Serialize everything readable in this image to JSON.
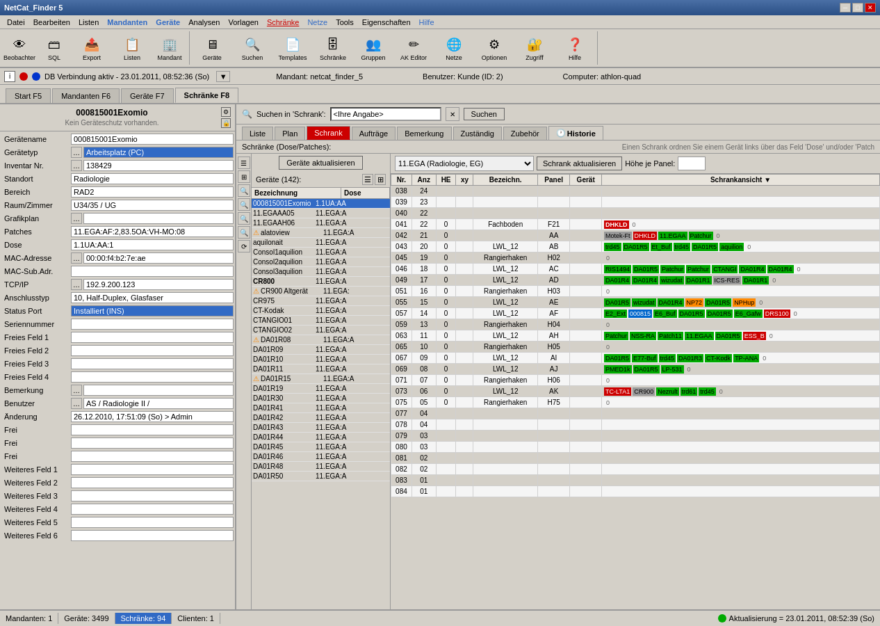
{
  "app": {
    "title": "NetCat_Finder 5",
    "controls": {
      "min": "─",
      "max": "□",
      "close": "✕"
    }
  },
  "menu": {
    "items": [
      "Datei",
      "Bearbeiten",
      "Listen",
      "Mandanten",
      "Geräte",
      "Analysen",
      "Vorlagen",
      "Schränke",
      "Netze",
      "Tools",
      "Eigenschaften",
      "Hilfe"
    ]
  },
  "toolbar": {
    "buttons": [
      {
        "label": "Beobachter",
        "icon": "👁"
      },
      {
        "label": "SQL",
        "icon": "🗃"
      },
      {
        "label": "Export",
        "icon": "📤"
      },
      {
        "label": "Listen",
        "icon": "📋"
      },
      {
        "label": "Mandant",
        "icon": "🏢"
      },
      {
        "label": "Geräte",
        "icon": "🖥"
      },
      {
        "label": "Suchen",
        "icon": "🔍"
      },
      {
        "label": "Templates",
        "icon": "📄"
      },
      {
        "label": "Schränke",
        "icon": "🗄"
      },
      {
        "label": "Gruppen",
        "icon": "👥"
      },
      {
        "label": "AK Editor",
        "icon": "✏"
      },
      {
        "label": "Netze",
        "icon": "🌐"
      },
      {
        "label": "Optionen",
        "icon": "⚙"
      },
      {
        "label": "Zugriff",
        "icon": "🔐"
      },
      {
        "label": "Hilfe",
        "icon": "❓"
      }
    ]
  },
  "status_top": {
    "info": "DB Verbindung aktiv - 23.01.2011, 08:52:36 (So)",
    "mandant": "Mandant: netcat_finder_5",
    "benutzer": "Benutzer: Kunde (ID: 2)",
    "computer": "Computer: athlon-quad"
  },
  "tabs": [
    {
      "label": "Start  F5"
    },
    {
      "label": "Mandanten  F6"
    },
    {
      "label": "Geräte  F7"
    },
    {
      "label": "Schränke  F8",
      "active": true
    }
  ],
  "device_header": {
    "title": "000815001Exomio",
    "subtitle": "Kein Geräteschutz vorhanden."
  },
  "device_fields": [
    {
      "label": "Gerätename",
      "value": "000815001Exomio",
      "icon": false
    },
    {
      "label": "Gerätetyp",
      "value": "Arbeitsplatz (PC)",
      "blue": true,
      "icon": true
    },
    {
      "label": "Inventar Nr.",
      "value": "138429",
      "icon": true
    },
    {
      "label": "Standort",
      "value": "Radiologie"
    },
    {
      "label": "Bereich",
      "value": "RAD2"
    },
    {
      "label": "Raum/Zimmer",
      "value": "U34/35 / UG"
    },
    {
      "label": "Grafikplan",
      "value": "",
      "icon": true
    },
    {
      "label": "Patches",
      "value": "11.EGA:AF:2,83.5OA:VH-MO:08"
    },
    {
      "label": "Dose",
      "value": "1.1UA:AA:1"
    },
    {
      "label": "MAC-Adresse",
      "value": "00:00:f4:b2:7e:ae",
      "icon": true
    },
    {
      "label": "MAC-Sub.Adr.",
      "value": ""
    },
    {
      "label": "TCP/IP",
      "value": "192.9.200.123",
      "icon": true
    },
    {
      "label": "Anschlusstyp",
      "value": "10, Half-Duplex, Glasfaser"
    },
    {
      "label": "Status Port",
      "value": "Installiert (INS)",
      "blue": true
    },
    {
      "label": "Seriennummer",
      "value": ""
    },
    {
      "label": "Freies Feld 1",
      "value": ""
    },
    {
      "label": "Freies Feld 2",
      "value": ""
    },
    {
      "label": "Freies Feld 3",
      "value": ""
    },
    {
      "label": "Freies Feld 4",
      "value": ""
    },
    {
      "label": "Bemerkung",
      "value": "",
      "icon": true
    },
    {
      "label": "Benutzer",
      "value": "AS / Radiologie II /",
      "icon": true
    },
    {
      "label": "Änderung",
      "value": "26.12.2010, 17:51:09 (So) > Admin"
    },
    {
      "label": "Frei",
      "value": ""
    },
    {
      "label": "Frei",
      "value": ""
    },
    {
      "label": "Frei",
      "value": ""
    },
    {
      "label": "Weiteres Feld 1",
      "value": ""
    },
    {
      "label": "Weiteres Feld 2",
      "value": ""
    },
    {
      "label": "Weiteres Feld 3",
      "value": ""
    },
    {
      "label": "Weiteres Feld 4",
      "value": ""
    },
    {
      "label": "Weiteres Feld 5",
      "value": ""
    },
    {
      "label": "Weiteres Feld 6",
      "value": ""
    }
  ],
  "search": {
    "label": "Suchen in 'Schrank':",
    "placeholder": "<Ihre Angabe>",
    "btn": "Suchen"
  },
  "sub_tabs": [
    {
      "label": "Liste"
    },
    {
      "label": "Plan"
    },
    {
      "label": "Schrank",
      "active": true
    },
    {
      "label": "Aufträge"
    },
    {
      "label": "Bemerkung"
    },
    {
      "label": "Zuständig"
    },
    {
      "label": "Zubehör"
    },
    {
      "label": "Historie"
    }
  ],
  "schrank_info": "Schränke (Dose/Patches):",
  "schrank_help": "Einen Schrank ordnen Sie einem Gerät links über das Feld 'Dose' und/oder 'Patch",
  "schrank_select": "11.EGA  (Radiologie, EG)",
  "schrank_update_btn": "Schrank aktualisieren",
  "hoehe_label": "Höhe je Panel:",
  "geraete_aktualisieren": "Geräte aktualisieren",
  "device_list_header": "Geräte (142):",
  "device_list_cols": [
    "Bezeichnung",
    "Dose"
  ],
  "devices": [
    {
      "name": "000815001Exomio",
      "dose": "1.1UA:AA",
      "selected": true,
      "warning": false
    },
    {
      "name": "11.EGAAA05",
      "dose": "11.EGA:A",
      "selected": false,
      "warning": false
    },
    {
      "name": "11.EGAAH06",
      "dose": "11.EGA:A",
      "selected": false,
      "warning": false
    },
    {
      "name": "alatoview",
      "dose": "11.EGA:A",
      "selected": false,
      "warning": false,
      "alert": true
    },
    {
      "name": "aquilonait",
      "dose": "11.EGA:A",
      "selected": false,
      "warning": false
    },
    {
      "name": "Consol1aquilion",
      "dose": "11.EGA:A",
      "selected": false,
      "warning": false
    },
    {
      "name": "Consol2aquilion",
      "dose": "11.EGA:A",
      "selected": false,
      "warning": false
    },
    {
      "name": "Consol3aquilion",
      "dose": "11.EGA:A",
      "selected": false,
      "warning": false
    },
    {
      "name": "CR800",
      "dose": "11.EGA:A",
      "selected": false,
      "warning": false,
      "bold": true
    },
    {
      "name": "CR900 Altgerät",
      "dose": "11.EGA:",
      "selected": false,
      "warning": true
    },
    {
      "name": "CR975",
      "dose": "11.EGA:A",
      "selected": false,
      "warning": false
    },
    {
      "name": "CT-Kodak",
      "dose": "11.EGA:A",
      "selected": false,
      "warning": false
    },
    {
      "name": "CTANGIO01",
      "dose": "11.EGA:A",
      "selected": false,
      "warning": false
    },
    {
      "name": "CTANGIO02",
      "dose": "11.EGA:A",
      "selected": false,
      "warning": false
    },
    {
      "name": "DA01R08",
      "dose": "11.EGA:A",
      "selected": false,
      "warning": true
    },
    {
      "name": "DA01R09",
      "dose": "11.EGA:A",
      "selected": false,
      "warning": false
    },
    {
      "name": "DA01R10",
      "dose": "11.EGA:A",
      "selected": false,
      "warning": false
    },
    {
      "name": "DA01R11",
      "dose": "11.EGA:A",
      "selected": false,
      "warning": false
    },
    {
      "name": "DA01R15",
      "dose": "11.EGA:A",
      "selected": false,
      "warning": true
    },
    {
      "name": "DA01R19",
      "dose": "11.EGA:A",
      "selected": false,
      "warning": false
    },
    {
      "name": "DA01R30",
      "dose": "11.EGA:A",
      "selected": false,
      "warning": false
    },
    {
      "name": "DA01R41",
      "dose": "11.EGA:A",
      "selected": false,
      "warning": false
    },
    {
      "name": "DA01R42",
      "dose": "11.EGA:A",
      "selected": false,
      "warning": false
    },
    {
      "name": "DA01R43",
      "dose": "11.EGA:A",
      "selected": false,
      "warning": false
    },
    {
      "name": "DA01R44",
      "dose": "11.EGA:A",
      "selected": false,
      "warning": false
    },
    {
      "name": "DA01R45",
      "dose": "11.EGA:A",
      "selected": false,
      "warning": false
    },
    {
      "name": "DA01R46",
      "dose": "11.EGA:A",
      "selected": false,
      "warning": false
    },
    {
      "name": "DA01R48",
      "dose": "11.EGA:A",
      "selected": false,
      "warning": false
    },
    {
      "name": "DA01R50",
      "dose": "11.EGA:A",
      "selected": false,
      "warning": false
    }
  ],
  "schrank_rows": [
    {
      "nr": "038",
      "anz": "24",
      "he": "",
      "xy": "",
      "bez": "",
      "panel": "",
      "geraet": "",
      "devices": []
    },
    {
      "nr": "039",
      "anz": "23",
      "he": "",
      "xy": "",
      "bez": "",
      "panel": "",
      "geraet": "",
      "devices": []
    },
    {
      "nr": "040",
      "anz": "22",
      "he": "",
      "xy": "",
      "bez": "",
      "panel": "",
      "geraet": "",
      "devices": []
    },
    {
      "nr": "041",
      "anz": "22",
      "he": "0",
      "xy": "",
      "bez": "Fachboden",
      "panel": "F21",
      "geraet": "",
      "devices": [
        {
          "label": "DHKLD",
          "color": "red",
          "bold": true
        }
      ]
    },
    {
      "nr": "042",
      "anz": "21",
      "he": "0",
      "xy": "",
      "bez": "",
      "panel": "AA",
      "geraet": "",
      "devices": [
        {
          "label": "Motek-Ft",
          "color": "gray"
        },
        {
          "label": "DHKLD",
          "color": "red"
        },
        {
          "label": "11.EGAA",
          "color": "green"
        },
        {
          "label": "Patchur",
          "color": "green"
        }
      ]
    },
    {
      "nr": "043",
      "anz": "20",
      "he": "0",
      "xy": "",
      "bez": "LWL_12",
      "panel": "AB",
      "geraet": "",
      "devices": [
        {
          "label": "trd45",
          "color": "green"
        },
        {
          "label": "DA01R5",
          "color": "green"
        },
        {
          "label": "Et_Buf",
          "color": "green"
        },
        {
          "label": "trd45",
          "color": "green"
        },
        {
          "label": "DA01R5",
          "color": "green"
        },
        {
          "label": "aquilion",
          "color": "green"
        }
      ]
    },
    {
      "nr": "045",
      "anz": "19",
      "he": "0",
      "xy": "",
      "bez": "Rangierhaken",
      "panel": "H02",
      "geraet": "",
      "devices": []
    },
    {
      "nr": "046",
      "anz": "18",
      "he": "0",
      "xy": "",
      "bez": "LWL_12",
      "panel": "AC",
      "geraet": "",
      "devices": [
        {
          "label": "RIS1494",
          "color": "green"
        },
        {
          "label": "DA01R5",
          "color": "green"
        },
        {
          "label": "Patchur",
          "color": "green"
        },
        {
          "label": "Patchur",
          "color": "green"
        },
        {
          "label": "CTANGI",
          "color": "green"
        },
        {
          "label": "DA01R4",
          "color": "green"
        },
        {
          "label": "DA01R4",
          "color": "green"
        }
      ]
    },
    {
      "nr": "049",
      "anz": "17",
      "he": "0",
      "xy": "",
      "bez": "LWL_12",
      "panel": "AD",
      "geraet": "",
      "devices": [
        {
          "label": "DA01R4",
          "color": "green"
        },
        {
          "label": "DA01R4",
          "color": "green"
        },
        {
          "label": "wizudat",
          "color": "green"
        },
        {
          "label": "DA01R1",
          "color": "green"
        },
        {
          "label": "ICS-RES",
          "color": "gray"
        },
        {
          "label": "DA01R1",
          "color": "green"
        }
      ]
    },
    {
      "nr": "051",
      "anz": "16",
      "he": "0",
      "xy": "",
      "bez": "Rangierhaken",
      "panel": "H03",
      "geraet": "",
      "devices": []
    },
    {
      "nr": "055",
      "anz": "15",
      "he": "0",
      "xy": "",
      "bez": "LWL_12",
      "panel": "AE",
      "geraet": "",
      "devices": [
        {
          "label": "DA01R5",
          "color": "green"
        },
        {
          "label": "wizudat",
          "color": "green"
        },
        {
          "label": "DA01R4",
          "color": "green"
        },
        {
          "label": "NP72",
          "color": "orange"
        },
        {
          "label": "DA01R5",
          "color": "green"
        },
        {
          "label": "NPHup",
          "color": "orange"
        }
      ]
    },
    {
      "nr": "057",
      "anz": "14",
      "he": "0",
      "xy": "",
      "bez": "LWL_12",
      "panel": "AF",
      "geraet": "",
      "devices": [
        {
          "label": "E2_Ext",
          "color": "green"
        },
        {
          "label": "000815",
          "color": "blue"
        },
        {
          "label": "E6_Buf",
          "color": "green"
        },
        {
          "label": "DA01R5",
          "color": "green"
        },
        {
          "label": "DA01R5",
          "color": "green"
        },
        {
          "label": "E6_Gafw",
          "color": "green"
        },
        {
          "label": "DRS100",
          "color": "red"
        }
      ]
    },
    {
      "nr": "059",
      "anz": "13",
      "he": "0",
      "xy": "",
      "bez": "Rangierhaken",
      "panel": "H04",
      "geraet": "",
      "devices": []
    },
    {
      "nr": "063",
      "anz": "11",
      "he": "0",
      "xy": "",
      "bez": "LWL_12",
      "panel": "AH",
      "geraet": "",
      "devices": [
        {
          "label": "Patchur",
          "color": "green"
        },
        {
          "label": "NSS-RA",
          "color": "green"
        },
        {
          "label": "Patch11",
          "color": "green"
        },
        {
          "label": "11.EGAA",
          "color": "green"
        },
        {
          "label": "DA01R5",
          "color": "green"
        },
        {
          "label": "ESS_B",
          "color": "red"
        }
      ]
    },
    {
      "nr": "065",
      "anz": "10",
      "he": "0",
      "xy": "",
      "bez": "Rangierhaken",
      "panel": "H05",
      "geraet": "",
      "devices": []
    },
    {
      "nr": "067",
      "anz": "09",
      "he": "0",
      "xy": "",
      "bez": "LWL_12",
      "panel": "AI",
      "geraet": "",
      "devices": [
        {
          "label": "DA01R5",
          "color": "green"
        },
        {
          "label": "E77-Buf",
          "color": "green"
        },
        {
          "label": "trd45",
          "color": "green"
        },
        {
          "label": "DA01R3",
          "color": "green"
        },
        {
          "label": "CT-Kodk",
          "color": "green"
        },
        {
          "label": "TP-ANA",
          "color": "green"
        }
      ]
    },
    {
      "nr": "069",
      "anz": "08",
      "he": "0",
      "xy": "",
      "bez": "LWL_12",
      "panel": "AJ",
      "geraet": "",
      "devices": [
        {
          "label": "PMED1k",
          "color": "green"
        },
        {
          "label": "DA01R5",
          "color": "green"
        },
        {
          "label": "LP-531",
          "color": "green"
        }
      ]
    },
    {
      "nr": "071",
      "anz": "07",
      "he": "0",
      "xy": "",
      "bez": "Rangierhaken",
      "panel": "H06",
      "geraet": "",
      "devices": []
    },
    {
      "nr": "073",
      "anz": "06",
      "he": "0",
      "xy": "",
      "bez": "LWL_12",
      "panel": "AK",
      "geraet": "",
      "devices": [
        {
          "label": "TC-LTA1",
          "color": "red"
        },
        {
          "label": "CR900",
          "color": "gray"
        },
        {
          "label": "Nezrult",
          "color": "green"
        },
        {
          "label": "trd61",
          "color": "green"
        },
        {
          "label": "trd45",
          "color": "green"
        }
      ]
    },
    {
      "nr": "075",
      "anz": "05",
      "he": "0",
      "xy": "",
      "bez": "Rangierhaken",
      "panel": "H75",
      "geraet": "",
      "devices": []
    },
    {
      "nr": "077",
      "anz": "04",
      "he": "",
      "xy": "",
      "bez": "",
      "panel": "",
      "geraet": "",
      "devices": []
    },
    {
      "nr": "078",
      "anz": "04",
      "he": "",
      "xy": "",
      "bez": "",
      "panel": "",
      "geraet": "",
      "devices": []
    },
    {
      "nr": "079",
      "anz": "03",
      "he": "",
      "xy": "",
      "bez": "",
      "panel": "",
      "geraet": "",
      "devices": []
    },
    {
      "nr": "080",
      "anz": "03",
      "he": "",
      "xy": "",
      "bez": "",
      "panel": "",
      "geraet": "",
      "devices": []
    },
    {
      "nr": "081",
      "anz": "02",
      "he": "",
      "xy": "",
      "bez": "",
      "panel": "",
      "geraet": "",
      "devices": []
    },
    {
      "nr": "082",
      "anz": "02",
      "he": "",
      "xy": "",
      "bez": "",
      "panel": "",
      "geraet": "",
      "devices": []
    },
    {
      "nr": "083",
      "anz": "01",
      "he": "",
      "xy": "",
      "bez": "",
      "panel": "",
      "geraet": "",
      "devices": []
    },
    {
      "nr": "084",
      "anz": "01",
      "he": "",
      "xy": "",
      "bez": "",
      "panel": "",
      "geraet": "",
      "devices": []
    }
  ],
  "bottom_status": {
    "mandanten": "Mandanten: 1",
    "geraete": "Geräte: 3499",
    "schraenke": "Schränke: 94",
    "clienten": "Clienten: 1",
    "aktualisierung": "Aktualisierung = 23.01.2011, 08:52:39 (So)"
  },
  "colors": {
    "active_tab_bg": "#cc0000",
    "selected_item": "#316ac5",
    "warning": "#ff8800"
  }
}
